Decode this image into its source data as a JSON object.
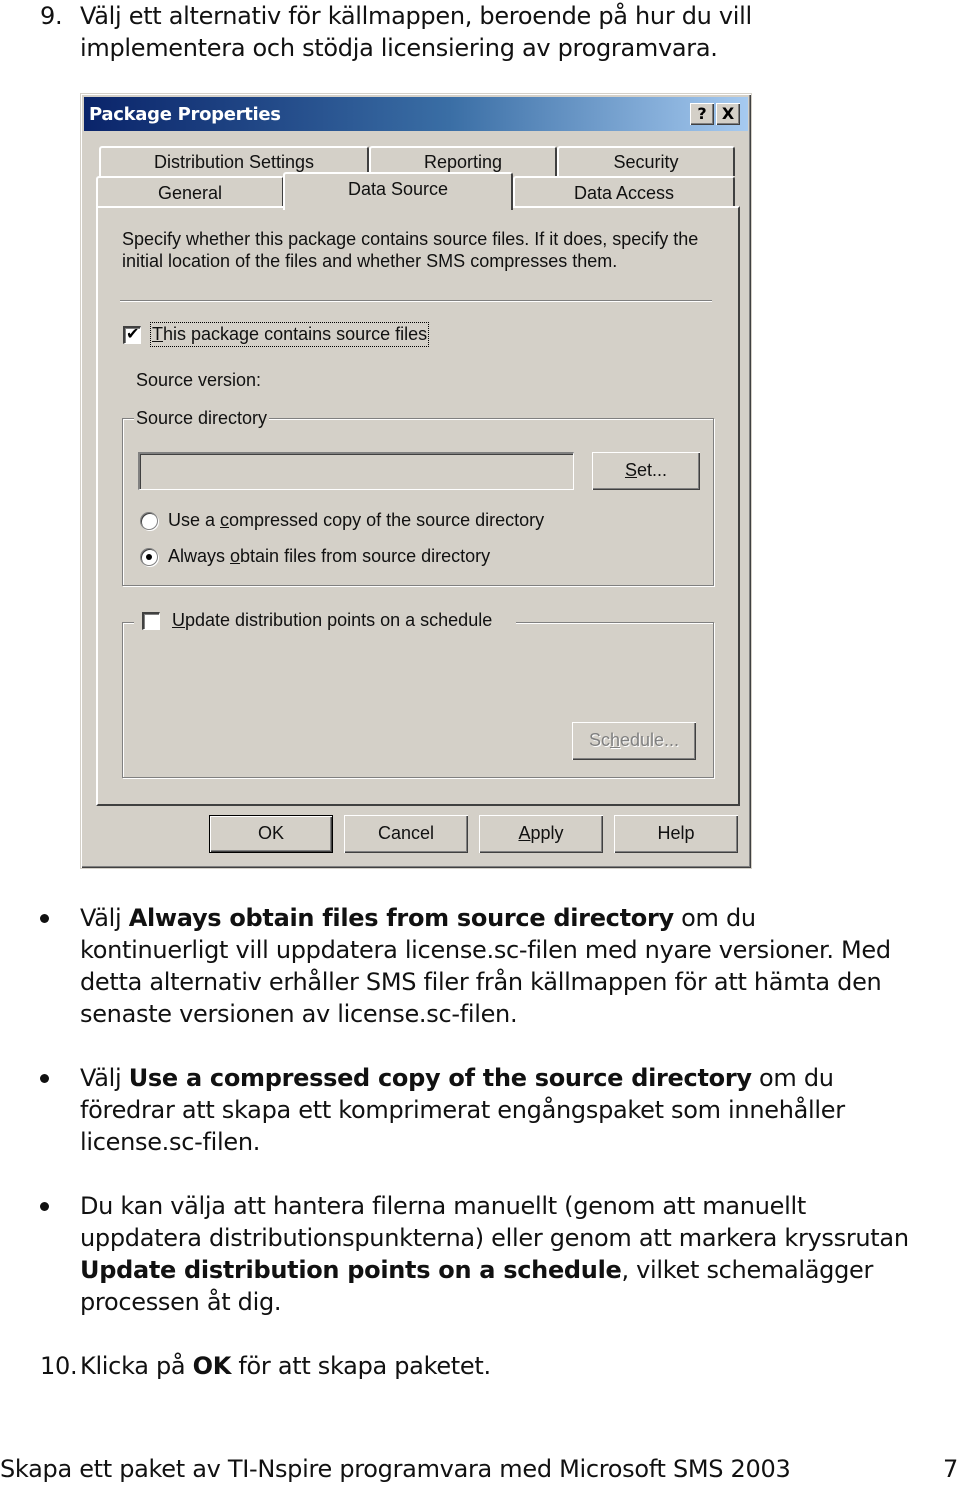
{
  "step9": {
    "number": "9.",
    "text_line1": "Välj ett alternativ för källmappen, beroende på hur du vill",
    "text_line2": "implementera och stödja licensiering av programvara."
  },
  "dialog": {
    "title": "Package Properties",
    "help_button": "?",
    "close_button": "X",
    "tabs_back_row": [
      "Distribution Settings",
      "Reporting",
      "Security"
    ],
    "tabs_front_row": [
      "General",
      "Data Source",
      "Data Access"
    ],
    "active_tab": "Data Source",
    "description_line1": "Specify whether this package contains source files.  If it does, specify the",
    "description_line2": "initial location of the files and whether SMS compresses them.",
    "contains_source_checkbox": {
      "label_ul": "T",
      "label_rest": "his package contains source files",
      "checked": true
    },
    "source_version_label": "Source version:",
    "source_directory_group": {
      "label": "Source directory",
      "input_value": "",
      "set_button": {
        "ul": "S",
        "rest": "et..."
      },
      "radio_compressed": {
        "pre": "Use a ",
        "ul": "c",
        "post": "ompressed copy of the source directory",
        "checked": false
      },
      "radio_always": {
        "pre": "Always ",
        "ul": "o",
        "post": "btain files from source directory",
        "checked": true
      }
    },
    "schedule_group": {
      "checkbox": {
        "ul": "U",
        "rest": "pdate distribution points on a schedule",
        "checked": false
      },
      "schedule_button": {
        "pre": "Sc",
        "ul": "h",
        "post": "edule...",
        "disabled": true
      }
    },
    "buttons": {
      "ok": "OK",
      "cancel": "Cancel",
      "apply": {
        "ul": "A",
        "rest": "pply"
      },
      "help": "Help"
    }
  },
  "bullets": [
    {
      "pre": "Välj ",
      "bold": "Always obtain files from source directory",
      "post": " om du",
      "lines": [
        "kontinuerligt vill uppdatera license.sc-filen med nyare versioner. Med",
        "detta alternativ erhåller SMS filer från källmappen för att hämta den",
        "senaste versionen av license.sc-filen."
      ]
    },
    {
      "pre": "Välj ",
      "bold": "Use a compressed copy of the source directory",
      "post": " om du",
      "lines": [
        "föredrar att skapa ett komprimerat engångspaket som innehåller",
        "license.sc-filen."
      ]
    },
    {
      "line1": "Du kan välja att hantera filerna manuellt (genom att manuellt",
      "line2": "uppdatera distributionspunkterna) eller genom att markera kryssrutan",
      "bold": "Update distribution points on a schedule",
      "post": ", vilket schemalägger",
      "line4": "processen åt dig."
    }
  ],
  "step10": {
    "number": "10.",
    "pre": "Klicka på ",
    "bold": "OK",
    "post": " för att skapa paketet."
  },
  "footer": {
    "title": "Skapa ett paket av TI-Nspire programvara med Microsoft SMS 2003",
    "page_number": "7"
  }
}
